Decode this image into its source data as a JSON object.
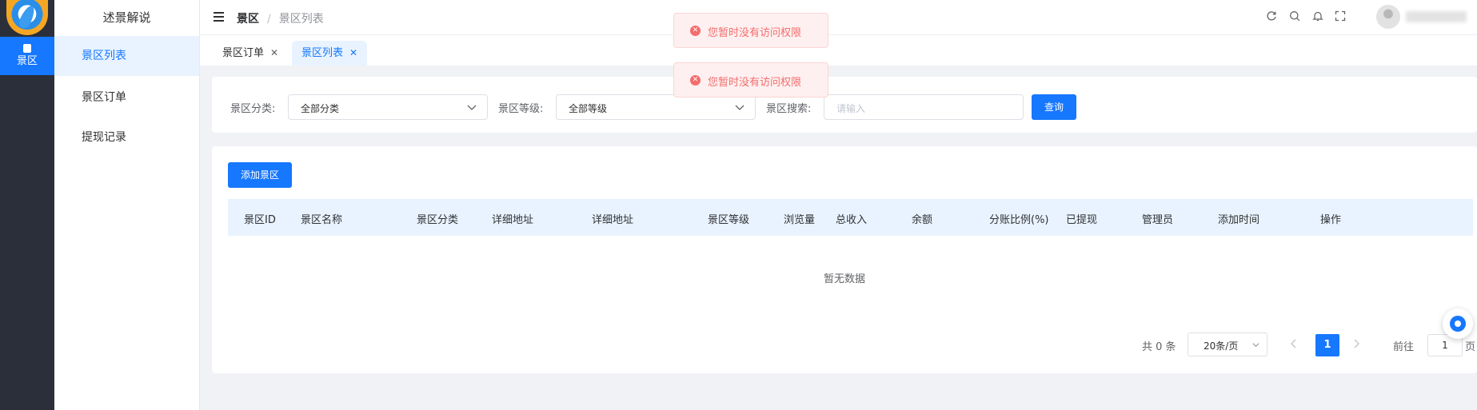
{
  "app": {
    "name": "述景解说"
  },
  "rail": {
    "items": [
      {
        "label": "景区"
      }
    ]
  },
  "sidebar": {
    "items": [
      {
        "label": "景区列表"
      },
      {
        "label": "景区订单"
      },
      {
        "label": "提现记录"
      }
    ]
  },
  "header": {
    "breadcrumb": [
      "景区",
      "景区列表"
    ],
    "icons": [
      "refresh-icon",
      "search-icon",
      "bell-icon",
      "fullscreen-icon"
    ]
  },
  "tabs": [
    {
      "label": "景区订单"
    },
    {
      "label": "景区列表"
    }
  ],
  "filter": {
    "category_label": "景区分类:",
    "category_value": "全部分类",
    "level_label": "景区等级:",
    "level_value": "全部等级",
    "search_label": "景区搜索:",
    "search_placeholder": "请输入",
    "query_button": "查询"
  },
  "table": {
    "add_button": "添加景区",
    "columns": [
      "景区ID",
      "景区名称",
      "景区分类",
      "详细地址",
      "详细地址",
      "景区等级",
      "浏览量",
      "总收入",
      "余额",
      "分账比例(%)",
      "已提现",
      "管理员",
      "添加时间",
      "操作"
    ],
    "empty_text": "暂无数据"
  },
  "pagination": {
    "total": "共 0 条",
    "page_size": "20条/页",
    "current_page": "1",
    "goto_prefix": "前往",
    "goto_value": "1",
    "goto_suffix": "页"
  },
  "toasts": [
    {
      "message": "您暂时没有访问权限"
    },
    {
      "message": "您暂时没有访问权限"
    }
  ],
  "colors": {
    "primary": "#1677ff",
    "rail_bg": "#2b2f3a",
    "error": "#f56c6c"
  }
}
